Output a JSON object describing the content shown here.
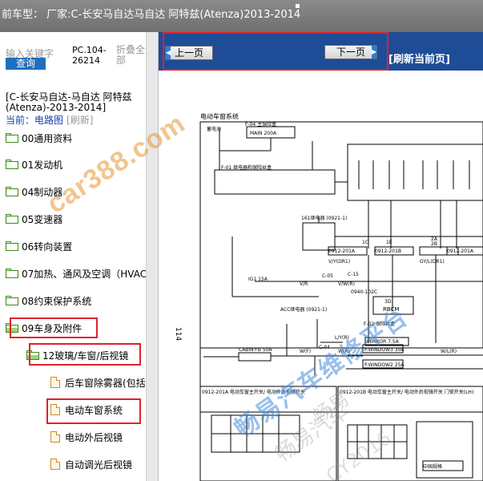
{
  "header": {
    "title": "前车型：  厂家:C-长安马自达马自达 阿特兹(Atenza)2013-2014"
  },
  "left": {
    "search_label": "输入关键字",
    "search_button": "查询",
    "model_code": "PC.104-26214",
    "collapse_all": "折叠全部",
    "model_full": "[C-长安马自达-马自达 阿特兹(Atenza)-2013-2014]",
    "current_prefix": "当前：",
    "current_link": "电路图",
    "refresh": "[刷新]",
    "tree": [
      {
        "label": "00通用资料",
        "type": "folder"
      },
      {
        "label": "01发动机",
        "type": "folder"
      },
      {
        "label": "04制动器",
        "type": "folder"
      },
      {
        "label": "05变速器",
        "type": "folder"
      },
      {
        "label": "06转向装置",
        "type": "folder"
      },
      {
        "label": "07加热、通风及空调（HVAC",
        "type": "folder"
      },
      {
        "label": "08约束保护系统",
        "type": "folder"
      },
      {
        "label": "09车身及附件",
        "type": "folder-open"
      },
      {
        "label": "12玻璃/车窗/后视镜",
        "type": "folder-open"
      },
      {
        "label": "后车窗除雾器(包括",
        "type": "doc"
      },
      {
        "label": "电动车窗系统",
        "type": "doc"
      },
      {
        "label": "电动外后视镜",
        "type": "doc"
      },
      {
        "label": "自动调光后视镜",
        "type": "doc"
      }
    ]
  },
  "toolbar": {
    "prev": "上一页",
    "next": "下一页",
    "refresh_page": "[刷新当前页]"
  },
  "diagram": {
    "title": "电动车窗系统",
    "page_number": "114",
    "labels": {
      "battery": "蓄电池",
      "f04": "F-04 主保险盒",
      "main": "MAIN 200A",
      "f01": "F-01 继电器和保险丝盒",
      "relay": "161继电器 (0921-1)",
      "r1": "1C",
      "r2": "1E",
      "r3": "2A",
      "r4": "2B",
      "c05": "C-05",
      "c15": "C-15",
      "c04": "C-04",
      "ign": "IG1 15A",
      "conn1": "0912-201A",
      "conn2": "0912-201B",
      "conn3": "0912-201A",
      "vr": "V/R",
      "vr2": "V/W(R)",
      "vr3": "V/Y(DR1)",
      "vr4": "GY/L(DR1)",
      "w": "W(F)",
      "wr": "W(R)",
      "lyr": "L/Y(R)",
      "wlr": "W/L(R)",
      "rbcm_code": "0940-102C",
      "rbcm": "RBCM",
      "rbcm_pin": "3D",
      "f02": "F-02 保险丝盒",
      "mirror": "MIRROR 7.5A",
      "pwin1": "P.WINDOW3 30A",
      "pwin2": "P.WINDOW2 25A",
      "cabin": "CABIN+B 50A",
      "acc": "ACC继电器 (0921-1)",
      "sw1": "0912-201A 电动车窗主开关/ 电动外后视镜开关",
      "sw2": "0912-201B 电动车窗主开关/ 电动外后视镜开关 门锁开关(LH)",
      "sw3": "0912-201A 电动车窗主开关/ 电动外后视镜开关",
      "china": "中国规格"
    }
  },
  "watermarks": {
    "site": "car388.com",
    "brand": "畅易汽车维修平台",
    "gray1": "畅易",
    "gray2": "CY2016",
    "gray3": "畅易汽车"
  },
  "colors": {
    "accent": "#1e4c97",
    "highlight": "#e0212b",
    "link": "#1a3ea8"
  }
}
